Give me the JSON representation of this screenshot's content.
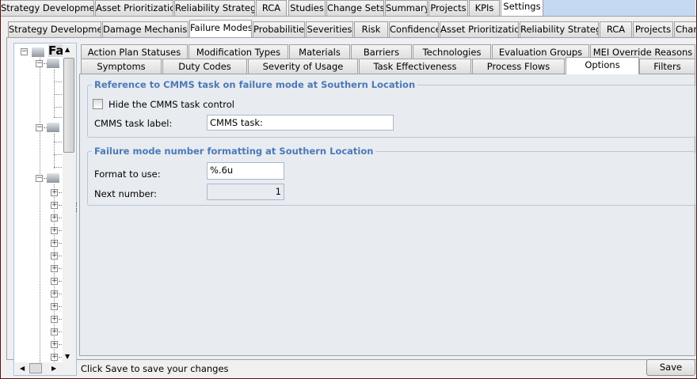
{
  "top_tabs": [
    "Strategy Development",
    "Asset Prioritization",
    "Reliability Strategy",
    "RCA",
    "Studies",
    "Change Sets",
    "Summary",
    "Projects",
    "KPIs",
    "Settings"
  ],
  "settings_tabs": [
    "Strategy Development",
    "Damage Mechanisms",
    "Failure Modes",
    "Probabilities",
    "Severities",
    "Risk",
    "Confidence",
    "Asset Prioritization",
    "Reliability Strategy",
    "RCA",
    "Projects",
    "Char"
  ],
  "fm_tabs_row1": [
    "Action Plan Statuses",
    "Modification Types",
    "Materials",
    "Barriers",
    "Technologies",
    "Evaluation Groups",
    "MEI Override Reasons"
  ],
  "fm_tabs_row2": [
    "Symptoms",
    "Duty Codes",
    "Severity of Usage",
    "Task Effectiveness",
    "Process Flows",
    "Options",
    "Filters"
  ],
  "tree": {
    "root_label": "Fa"
  },
  "cmms_group": {
    "title": "Reference to CMMS task on failure mode at Southern Location",
    "hide_checkbox_label": "Hide the CMMS task control",
    "hide_checked": false,
    "task_label_label": "CMMS task label:",
    "task_label_value": "CMMS task:"
  },
  "number_group": {
    "title": "Failure mode number formatting at Southern Location",
    "format_label": "Format to use:",
    "format_value": "%.6u",
    "next_label": "Next number:",
    "next_value": "1"
  },
  "status": {
    "message": "Click Save to save your changes",
    "save_label": "Save"
  }
}
